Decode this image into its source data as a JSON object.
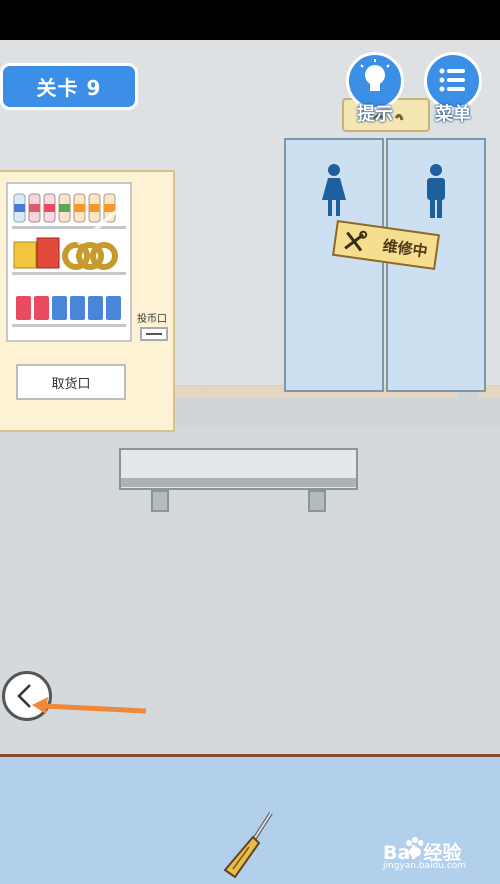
{
  "level": {
    "label": "关卡 9"
  },
  "buttons": {
    "hint_label": "提示",
    "menu_label": "菜单"
  },
  "vending_machine": {
    "coin_slot_label": "投币口",
    "pickup_label": "取货口"
  },
  "restroom": {
    "sign_text": "维修中"
  },
  "inventory": {
    "items": [
      "screwdriver-icon"
    ]
  },
  "watermark": {
    "brand": "Bai 经验",
    "url": "jingyan.baidu.com"
  },
  "colors": {
    "accent": "#3b8fe6",
    "wall": "#dde1e3",
    "inventory_bg": "#b2d0ec",
    "sign": "#f7dd8f",
    "arrow": "#f0883a"
  }
}
